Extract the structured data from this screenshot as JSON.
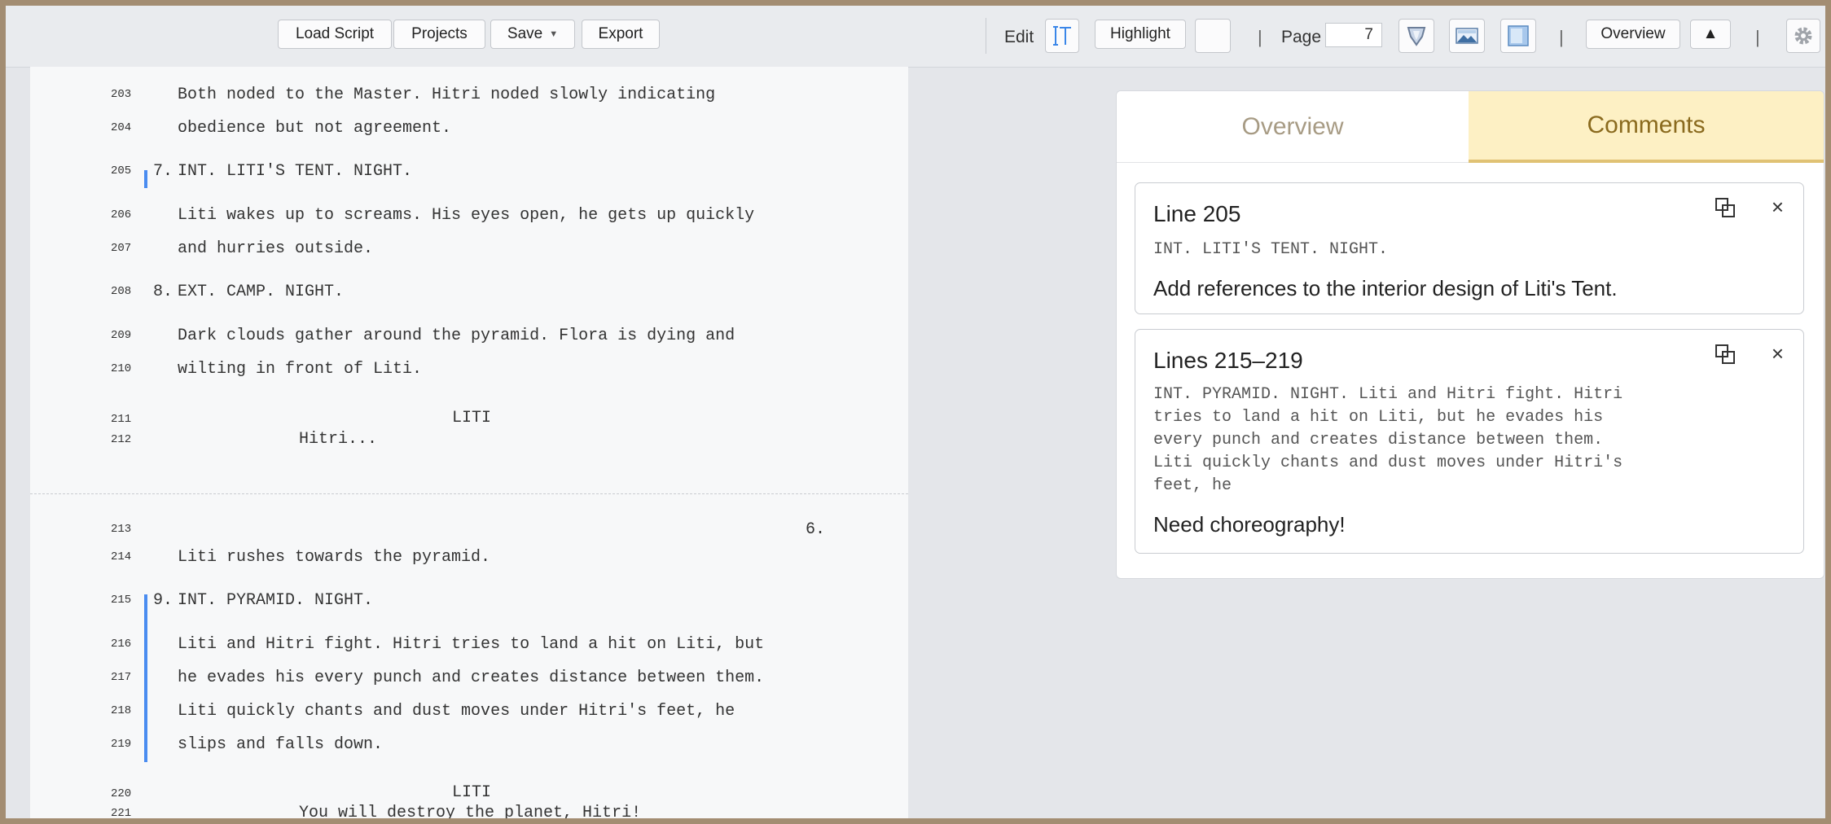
{
  "toolbar": {
    "load_script": "Load Script",
    "projects": "Projects",
    "save": "Save",
    "export": "Export",
    "edit_label": "Edit",
    "highlight": "Highlight",
    "separator": "|",
    "page_label": "Page",
    "page_value": "7",
    "overview": "Overview",
    "up_arrow": "▲",
    "icons": [
      "text-cursor-icon",
      "color-swatch-icon",
      "shield-icon",
      "image-icon",
      "panel-icon",
      "gear-icon"
    ]
  },
  "script": {
    "lines": [
      {
        "num": "203",
        "text": "Both noded to the Master. Hitri noded slowly indicating"
      },
      {
        "num": "204",
        "text": "obedience but not agreement."
      },
      {
        "num": "205",
        "scene": "7.",
        "text": "INT. LITI'S TENT. NIGHT."
      },
      {
        "num": "206",
        "text": "Liti wakes up to screams. His eyes open, he gets up quickly"
      },
      {
        "num": "207",
        "text": "and hurries outside."
      },
      {
        "num": "208",
        "scene": "8.",
        "text": "EXT. CAMP. NIGHT."
      },
      {
        "num": "209",
        "text": "Dark clouds gather around the pyramid. Flora is dying and"
      },
      {
        "num": "210",
        "text": "wilting in front of Liti."
      },
      {
        "num": "211",
        "text": "LITI"
      },
      {
        "num": "212",
        "text": "Hitri..."
      },
      {
        "num": "213",
        "text": "6."
      },
      {
        "num": "214",
        "text": "Liti rushes towards the pyramid."
      },
      {
        "num": "215",
        "scene": "9.",
        "text": "INT. PYRAMID. NIGHT."
      },
      {
        "num": "216",
        "text": "Liti and Hitri fight. Hitri tries to land a hit on Liti, but"
      },
      {
        "num": "217",
        "text": "he evades his every punch and creates distance between them."
      },
      {
        "num": "218",
        "text": "Liti quickly chants and dust moves under Hitri's feet, he"
      },
      {
        "num": "219",
        "text": "slips and falls down."
      },
      {
        "num": "220",
        "text": "LITI"
      },
      {
        "num": "221",
        "text": "You will destroy the planet, Hitri!"
      }
    ]
  },
  "panel": {
    "tab_overview": "Overview",
    "tab_comments": "Comments",
    "comments": [
      {
        "title": "Line 205",
        "quote": "INT. LITI'S TENT. NIGHT.",
        "note": "Add references to the interior design of Liti's Tent."
      },
      {
        "title": "Lines 215–219",
        "quote": "INT. PYRAMID. NIGHT. Liti and Hitri fight. Hitri\ntries to land a hit on Liti, but he evades his\nevery punch and creates distance between them.\nLiti quickly chants and dust moves under Hitri's\nfeet, he",
        "note": "Need choreography!"
      }
    ],
    "close_glyph": "×"
  },
  "colors": {
    "frame_border": "#a38d72",
    "highlight_bar": "#4a8cf0",
    "comments_tab_bg": "#fdf0c4",
    "comments_tab_text": "#8a6a1e"
  }
}
